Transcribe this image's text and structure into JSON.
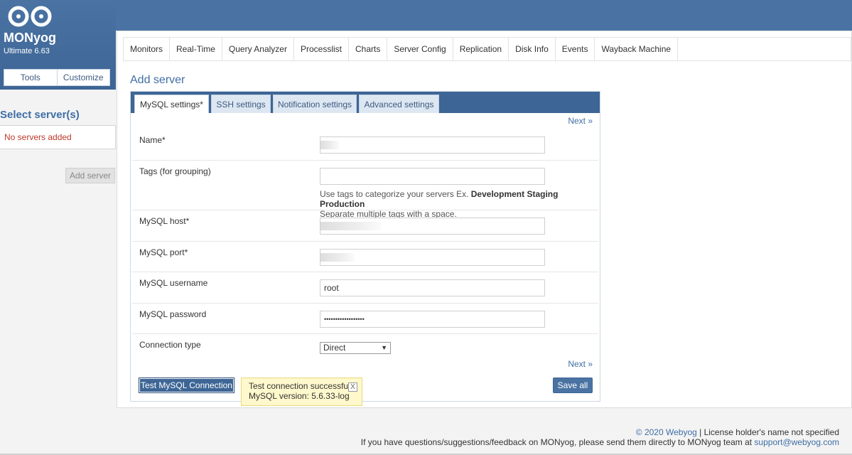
{
  "brand": {
    "name": "MONyog",
    "edition": "Ultimate 6.63"
  },
  "sidebar": {
    "tools_label": "Tools",
    "customize_label": "Customize",
    "select_title": "Select server(s)",
    "no_servers": "No servers added",
    "add_server_label": "Add server"
  },
  "nav": {
    "items": [
      "Monitors",
      "Real-Time",
      "Query Analyzer",
      "Processlist",
      "Charts",
      "Server Config",
      "Replication",
      "Disk Info",
      "Events",
      "Wayback Machine"
    ]
  },
  "page": {
    "title": "Add server",
    "tabs": [
      "MySQL settings*",
      "SSH settings",
      "Notification settings",
      "Advanced settings"
    ],
    "next_label": "Next »",
    "fields": {
      "name_label": "Name*",
      "tags_label": "Tags (for grouping)",
      "tags_hint_prefix": "Use tags to categorize your servers Ex. ",
      "tags_hint_examples": "Development Staging Production",
      "tags_hint_line2": "Separate multiple tags with a space.",
      "host_label": "MySQL host*",
      "port_label": "MySQL port*",
      "username_label": "MySQL username",
      "username_value": "root",
      "password_label": "MySQL password",
      "password_value": "••••••••••••••••••",
      "conn_type_label": "Connection type",
      "conn_type_value": "Direct"
    },
    "test_button": "Test MySQL Connection",
    "toast_line1": "Test connection successful!",
    "toast_line2": "MySQL version: 5.6.33-log",
    "toast_close": "X",
    "save_button": "Save all"
  },
  "footer": {
    "copyright_link": "© 2020 Webyog",
    "license_text": " | License holder's name not specified",
    "feedback_text": "If you have questions/suggestions/feedback on MONyog, please send them directly to MONyog team at ",
    "support_email": "support@webyog.com"
  },
  "colors": {
    "header": "#4a73a3",
    "accent": "#3f6ea5",
    "error": "#c0392b",
    "toast_bg": "#fff8cc"
  }
}
